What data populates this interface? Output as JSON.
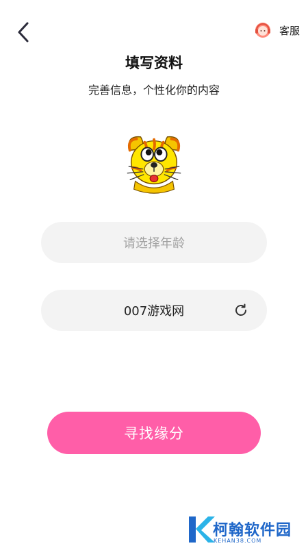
{
  "header": {
    "customer_service_label": "客服",
    "title": "填写资料",
    "subtitle": "完善信息，个性化你的内容"
  },
  "avatar": {
    "icon": "cat-avatar-icon"
  },
  "form": {
    "age_placeholder": "请选择年龄",
    "nickname_value": "007游戏网"
  },
  "cta": {
    "label": "寻找缘分"
  },
  "watermark": {
    "title": "柯翰软件园",
    "domain": "KEHAN38.COM"
  },
  "colors": {
    "accent": "#ff5ea8",
    "field_bg": "#f3f3f3",
    "placeholder": "#a2a2a2"
  }
}
